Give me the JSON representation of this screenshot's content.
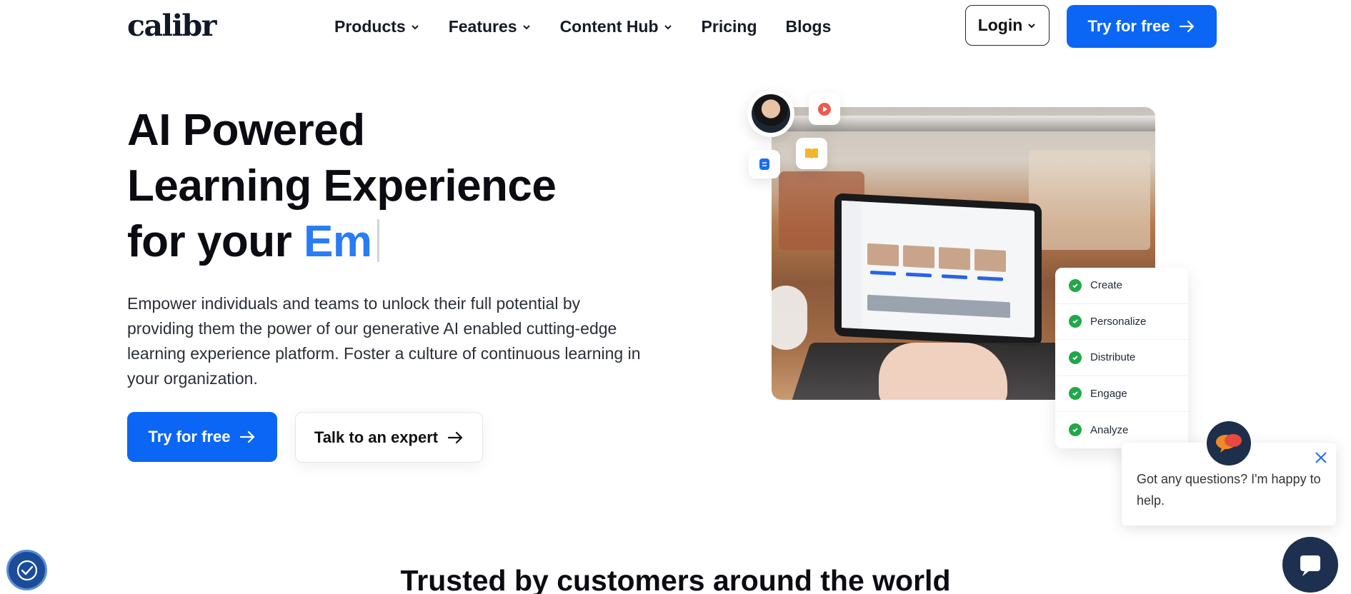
{
  "header": {
    "logo": "calibr",
    "nav": [
      {
        "label": "Products",
        "dropdown": true
      },
      {
        "label": "Features",
        "dropdown": true
      },
      {
        "label": "Content Hub",
        "dropdown": true
      },
      {
        "label": "Pricing",
        "dropdown": false
      },
      {
        "label": "Blogs",
        "dropdown": false
      }
    ],
    "login_label": "Login",
    "try_label": "Try for free"
  },
  "hero": {
    "title_line1": "AI Powered",
    "title_line2": "Learning Experience",
    "title_line3": "for your",
    "typed_text": "Em",
    "description": "Empower individuals and teams to unlock their full potential by providing them the power of our generative AI enabled cutting-edge learning experience platform. Foster a culture of continuous learning in your organization.",
    "primary_cta": "Try for free",
    "secondary_cta": "Talk to an expert"
  },
  "steps": [
    "Create",
    "Personalize",
    "Distribute",
    "Engage",
    "Analyze"
  ],
  "chat": {
    "message": "Got any questions? I'm happy to help."
  },
  "trusted_heading": "Trusted by customers around the world",
  "colors": {
    "brand_blue": "#0b66f5",
    "typed_blue": "#2a7cf5",
    "check_green": "#22a84a",
    "chat_navy": "#1e3050"
  },
  "icons": [
    "chevron-down-icon",
    "arrow-right-icon",
    "play-icon",
    "book-icon",
    "doc-icon",
    "check-icon",
    "chat-icon",
    "close-icon",
    "accessibility-icon"
  ]
}
